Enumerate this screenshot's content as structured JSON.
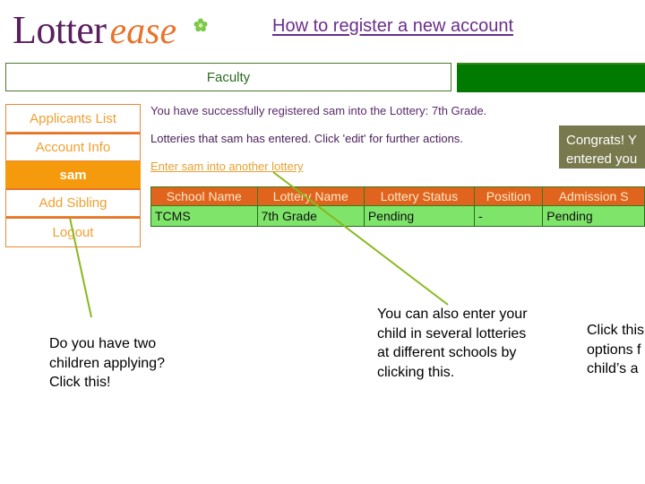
{
  "logo": {
    "part1": "Lotter",
    "part2": "ease",
    "flower_icon": "flower-icon"
  },
  "page_title": "How to register a new account",
  "nav": {
    "faculty_tab": "Faculty"
  },
  "sidebar": {
    "items": [
      {
        "label": "Applicants List",
        "active": false
      },
      {
        "label": "Account Info",
        "active": false
      },
      {
        "label": "sam",
        "active": true
      },
      {
        "label": "Add Sibling",
        "active": false
      },
      {
        "label": "Logout",
        "active": false
      }
    ]
  },
  "main": {
    "success_message": "You have successfully registered sam into the Lottery: 7th Grade.",
    "lotteries_message": "Lotteries that sam has entered. Click 'edit' for further actions.",
    "enter_another_link": "Enter sam into another lottery",
    "table": {
      "headers": [
        "School Name",
        "Lottery Name",
        "Lottery Status",
        "Position",
        "Admission S"
      ],
      "rows": [
        [
          "TCMS",
          "7th Grade",
          "Pending",
          "-",
          "Pending"
        ]
      ]
    }
  },
  "callouts": {
    "congrats_line1": "Congrats! Y",
    "congrats_line2": "entered you",
    "sibling_note": "Do you have two children applying? Click this!",
    "lottery_note": "You can also enter your child in several lotteries at different schools by clicking this.",
    "click_note_line1": "Click this",
    "click_note_line2": "options f",
    "click_note_line3": "child’s a"
  },
  "colors": {
    "brand_purple": "#5a1f5e",
    "brand_orange": "#e8742a",
    "nav_green": "#007a00",
    "table_header": "#e0641e",
    "table_row": "#7ee46a",
    "connector": "#8ab820"
  }
}
